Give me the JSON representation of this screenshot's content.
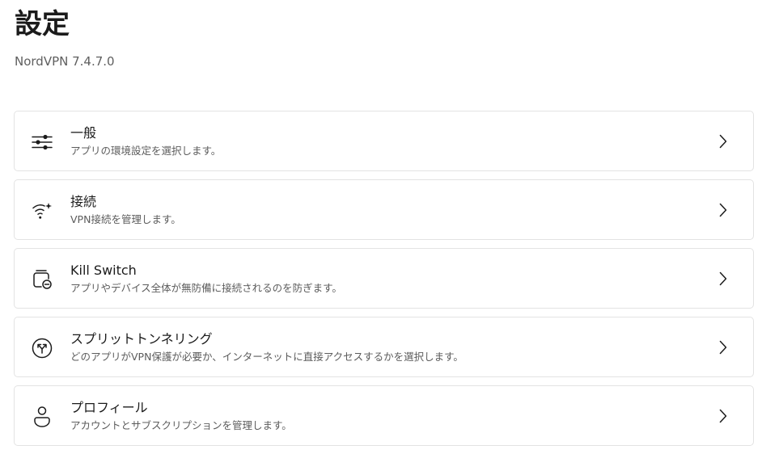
{
  "header": {
    "title": "設定",
    "version": "NordVPN 7.4.7.0"
  },
  "settings": [
    {
      "title": "一般",
      "description": "アプリの環境設定を選択します。",
      "icon": "sliders-icon"
    },
    {
      "title": "接続",
      "description": "VPN接続を管理します。",
      "icon": "wifi-sparkle-icon"
    },
    {
      "title": "Kill Switch",
      "description": "アプリやデバイス全体が無防備に接続されるのを防ぎます。",
      "icon": "kill-switch-icon"
    },
    {
      "title": "スプリットトンネリング",
      "description": "どのアプリがVPN保護が必要か、インターネットに直接アクセスするかを選択します。",
      "icon": "split-arrows-icon"
    },
    {
      "title": "プロフィール",
      "description": "アカウントとサブスクリプションを管理します。",
      "icon": "user-icon"
    }
  ],
  "colors": {
    "text": "#1b1b1b",
    "secondary_text": "#5c5c5c",
    "card_border": "#e3e3e3"
  }
}
